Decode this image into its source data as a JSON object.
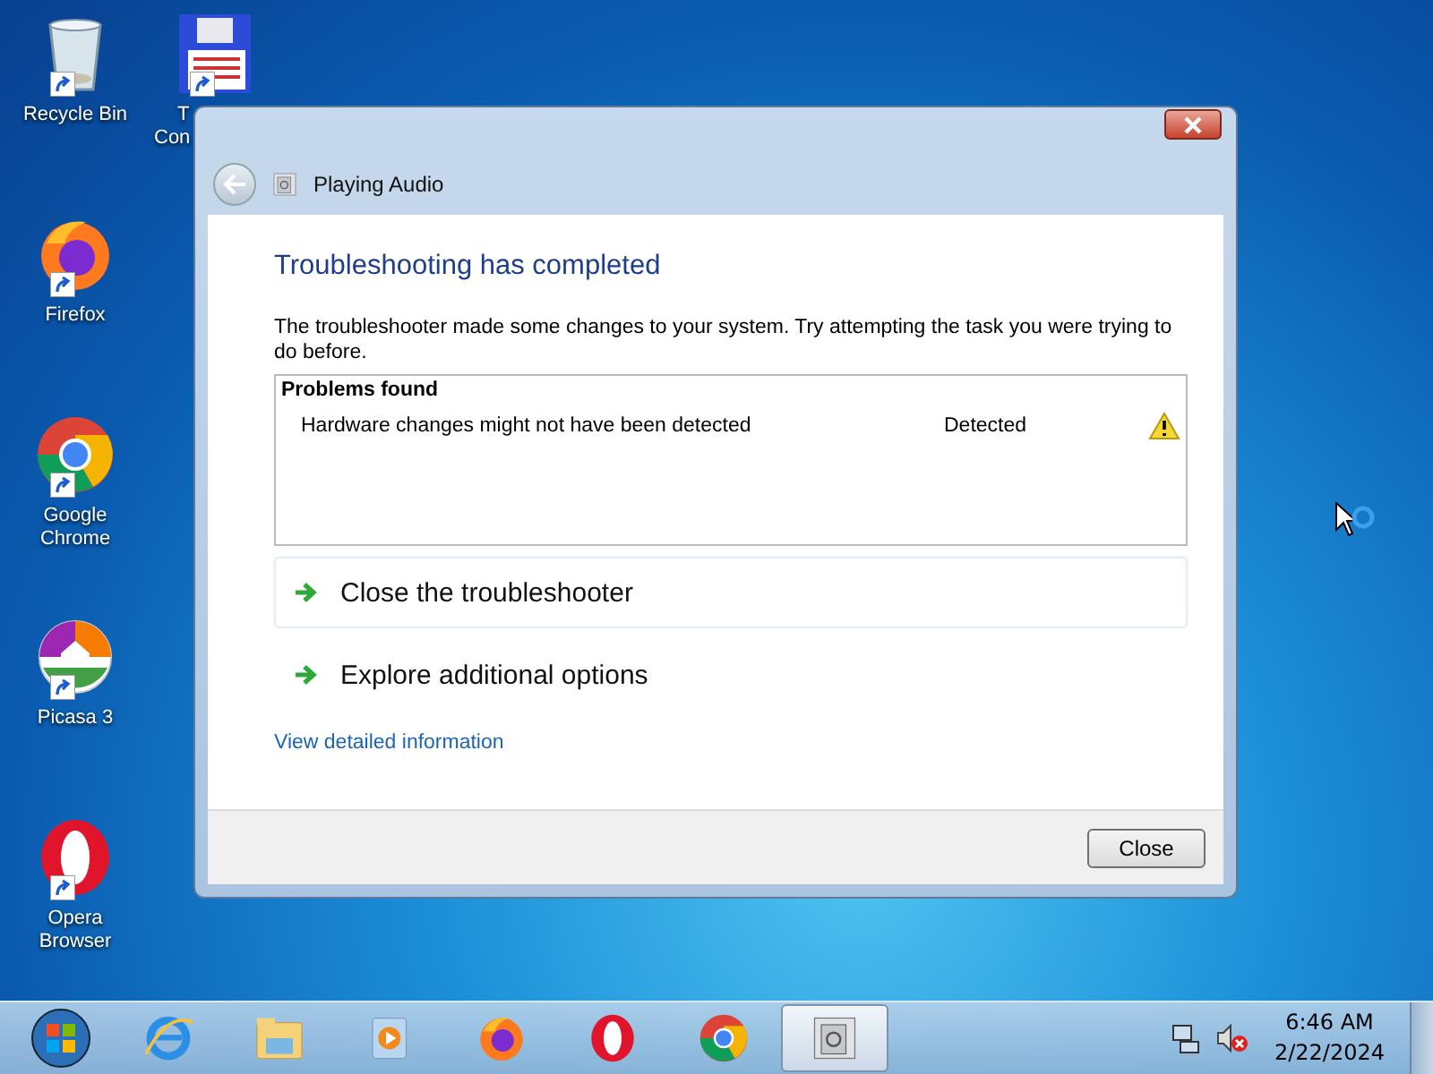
{
  "desktop_icons": [
    {
      "kind": "recycle",
      "lines": [
        "Recycle Bin"
      ]
    },
    {
      "kind": "floppy",
      "lines": [
        "T",
        "Con"
      ]
    },
    {
      "kind": "firefox",
      "lines": [
        "Firefox"
      ]
    },
    {
      "kind": "chrome",
      "lines": [
        "Google",
        "Chrome"
      ]
    },
    {
      "kind": "picasa",
      "lines": [
        "Picasa 3"
      ]
    },
    {
      "kind": "opera",
      "lines": [
        "Opera",
        "Browser"
      ]
    }
  ],
  "window": {
    "title": "Playing Audio",
    "heading": "Troubleshooting has completed",
    "message": "The troubleshooter made some changes to your system. Try attempting the task you were trying to do before.",
    "problems": {
      "header": "Problems found",
      "rows": [
        {
          "problem": "Hardware changes might not have been detected",
          "status": "Detected",
          "kind": "warning"
        }
      ]
    },
    "options": [
      {
        "label": "Close the troubleshooter",
        "selected": true
      },
      {
        "label": "Explore additional options",
        "selected": false
      }
    ],
    "link": "View detailed information",
    "buttons": [
      "Close"
    ]
  },
  "taskbar": {
    "apps": [
      {
        "kind": "ie",
        "selected": false
      },
      {
        "kind": "explorer",
        "selected": false
      },
      {
        "kind": "media",
        "selected": false
      },
      {
        "kind": "firefox",
        "selected": false
      },
      {
        "kind": "opera",
        "selected": false
      },
      {
        "kind": "chrome",
        "selected": false
      },
      {
        "kind": "troubleshooter",
        "selected": true
      }
    ],
    "time": "6:46 AM",
    "date": "2/22/2024"
  }
}
